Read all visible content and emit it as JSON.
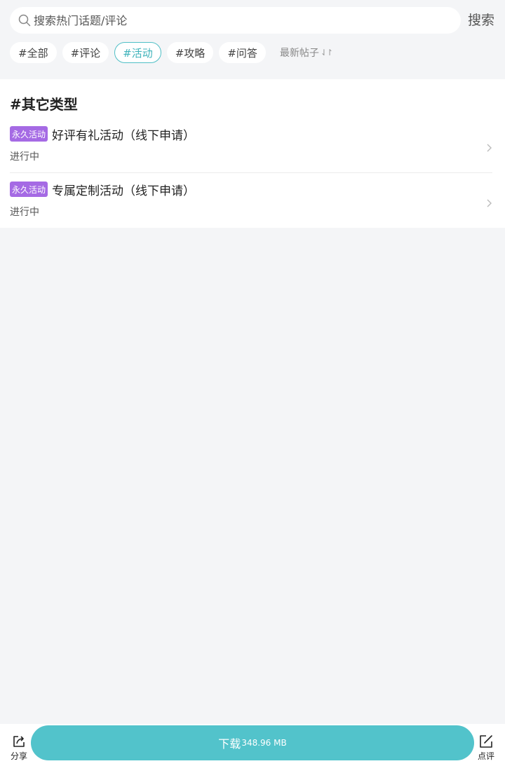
{
  "search": {
    "placeholder": "搜索热门话题/评论",
    "button": "搜索"
  },
  "tags": [
    {
      "label": "#全部",
      "active": false
    },
    {
      "label": "#评论",
      "active": false
    },
    {
      "label": "#活动",
      "active": true
    },
    {
      "label": "#攻略",
      "active": false
    },
    {
      "label": "#问答",
      "active": false
    }
  ],
  "sort": {
    "label": "最新帖子",
    "icon": "sort-arrows-icon"
  },
  "section": {
    "title": "#其它类型",
    "items": [
      {
        "badge": "永久活动",
        "title": "好评有礼活动（线下申请）",
        "status": "进行中"
      },
      {
        "badge": "永久活动",
        "title": "专属定制活动（线下申请）",
        "status": "进行中"
      }
    ]
  },
  "bottom": {
    "share_label": "分享",
    "download_label": "下载",
    "download_size": "348.96 MB",
    "review_label": "点评"
  },
  "colors": {
    "accent": "#52c3cb",
    "active_tag": "#3fb3bb",
    "badge": "#a56ae4",
    "background": "#f4f5f7"
  }
}
